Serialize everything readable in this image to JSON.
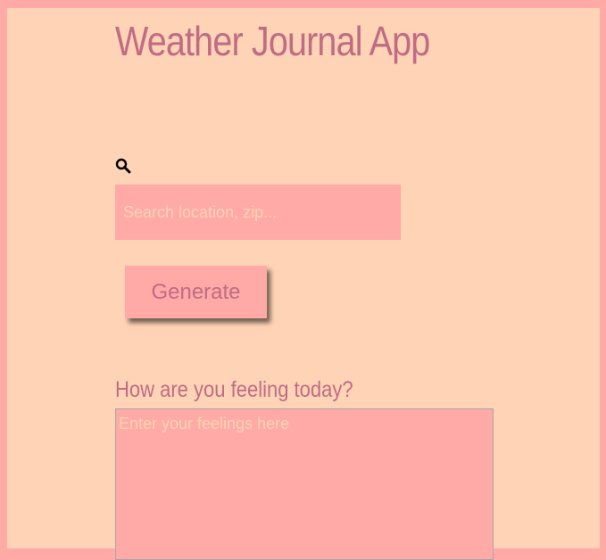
{
  "app": {
    "title": "Weather Journal App"
  },
  "search": {
    "icon": "search-icon",
    "placeholder": "Search location, zip..."
  },
  "actions": {
    "generate_label": "Generate"
  },
  "feelings": {
    "label": "How are you feeling today?",
    "placeholder": "Enter your feelings here"
  },
  "colors": {
    "page_border": "#ffaaa6",
    "background": "#ffd3b5",
    "accent_text": "#c06c84",
    "field_background": "#ffaaa6"
  }
}
